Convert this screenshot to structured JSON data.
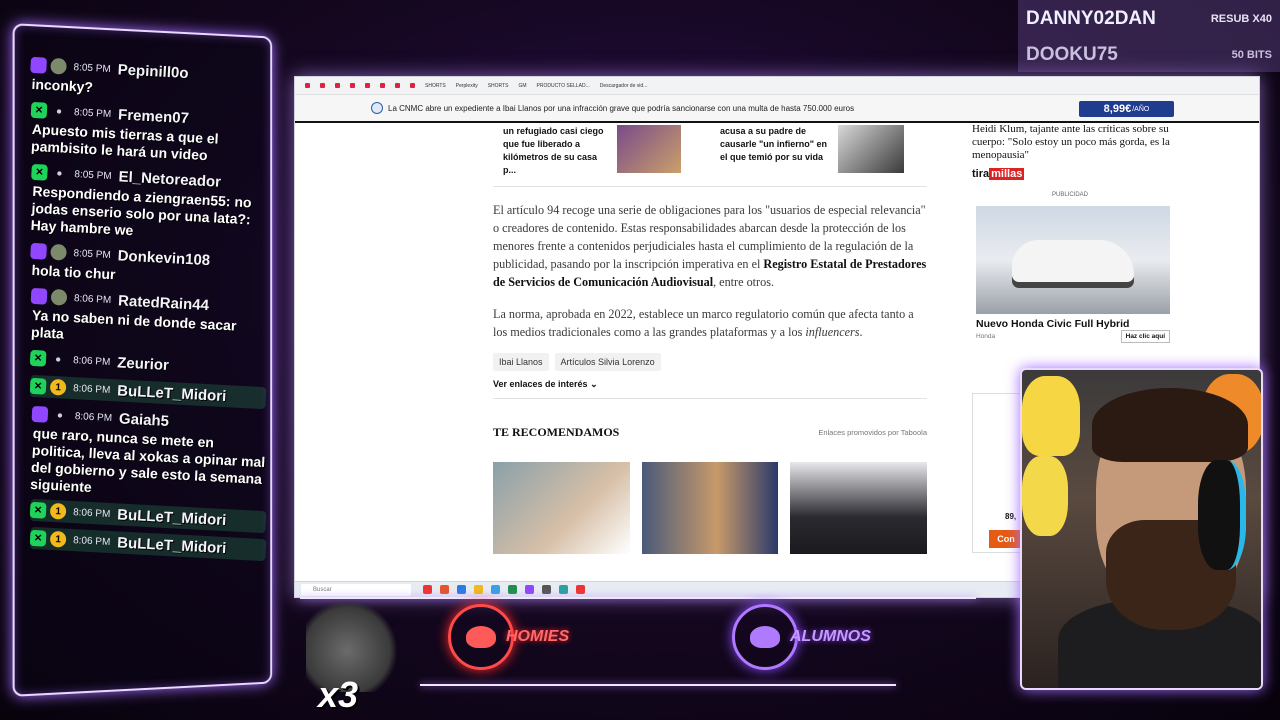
{
  "chat": {
    "messages": [
      {
        "time": "8:05 PM",
        "user": "Pepinill0o",
        "text": "inconky?",
        "badges": [
          "twitch-icon",
          "avatar-icon"
        ]
      },
      {
        "time": "8:05 PM",
        "user": "Fremen07",
        "text": "Apuesto mis tierras a que el pambisito le hará un video",
        "badges": [
          "kick-icon",
          "user-icon"
        ]
      },
      {
        "time": "8:05 PM",
        "user": "El_Netoreador",
        "text": "Respondiendo a ziengraen55: no jodas enserio solo por una lata?: Hay hambre we",
        "badges": [
          "kick-icon",
          "user-icon"
        ]
      },
      {
        "time": "8:05 PM",
        "user": "Donkevin108",
        "text": "hola tio chur",
        "badges": [
          "twitch-icon",
          "avatar-icon"
        ]
      },
      {
        "time": "8:06 PM",
        "user": "RatedRain44",
        "text": "Ya no saben ni de donde sacar plata",
        "badges": [
          "twitch-icon",
          "avatar-icon"
        ]
      },
      {
        "time": "8:06 PM",
        "user": "Zeurior",
        "text": "",
        "badges": [
          "kick-icon",
          "user-icon"
        ]
      },
      {
        "time": "8:06 PM",
        "user": "BuLLeT_Midori",
        "text": "",
        "badges": [
          "kick-icon",
          "sub-icon"
        ]
      },
      {
        "time": "8:06 PM",
        "user": "Gaiah5",
        "text": "que raro, nunca se mete en politica, lleva al xokas a opinar mal del gobierno y sale esto la semana siguiente",
        "badges": [
          "twitch-icon",
          "user-icon"
        ]
      },
      {
        "time": "8:06 PM",
        "user": "BuLLeT_Midori",
        "text": "",
        "badges": [
          "kick-icon",
          "sub-icon"
        ]
      },
      {
        "time": "8:06 PM",
        "user": "BuLLeT_Midori",
        "text": "",
        "badges": [
          "kick-icon",
          "sub-icon"
        ]
      }
    ],
    "sub_badge_count": "1"
  },
  "subs": {
    "top_name": "DANNY02DAN",
    "top_tag": "RESUB X40",
    "second_name": "DOOKU75",
    "second_tag": "50 BITS"
  },
  "browser": {
    "bookmarks": [
      "SHORTS",
      "Perplexity",
      "SHORTS",
      "GM",
      "PRODUCTO SELLAD...",
      "Descargador de vid..."
    ],
    "notice": "La CNMC abre un expediente a Ibai Llanos por una infracción grave que podría sancionarse con una multa de hasta 750.000 euros",
    "price": "8,99€",
    "price_unit": "/AÑO",
    "related": [
      {
        "text": "un refugiado casi ciego que fue liberado a kilómetros de su casa p..."
      },
      {
        "text": "acusa a su padre de causarle \"un infierno\" en el que temió por su vida"
      }
    ],
    "paragraph1_a": "El artículo 94 recoge una serie de obligaciones para los \"usuarios de especial relevancia\" o creadores de contenido. Estas responsabilidades abarcan desde la protección de los menores frente a contenidos perjudiciales hasta el cumplimiento de la regulación de la publicidad, pasando por la inscripción imperativa en el ",
    "paragraph1_bold": "Registro Estatal de Prestadores de Servicios de Comunicación Audiovisual",
    "paragraph1_b": ", entre otros.",
    "paragraph2_a": "La norma, aprobada en 2022, establece un marco regulatorio común que afecta tanto a los medios tradicionales como a las grandes plataformas y a los ",
    "paragraph2_em": "influencers",
    "paragraph2_b": ".",
    "tags": [
      "Ibai Llanos",
      "Artículos Silvia Lorenzo"
    ],
    "links_label": "Ver enlaces de interés",
    "rec_title": "TE RECOMENDAMOS",
    "rec_sponsor": "Enlaces promovidos por Taboola",
    "side_headline": "Heidi Klum, tajante ante las críticas sobre su cuerpo: \"Solo estoy un poco más gorda, es la menopausia\"",
    "side_logo_a": "tira",
    "side_logo_b": "millas",
    "publicidad": "PUBLICIDAD",
    "ad_title": "Nuevo Honda Civic Full Hybrid",
    "ad_brand": "Honda",
    "ad_cta": "Haz clic aquí",
    "ad2_price": "89,",
    "ad2_btn": "Con",
    "taskbar_search": "Buscar"
  },
  "overlay": {
    "logo1": "HOMIES",
    "logo2": "ALUMNOS",
    "fish_multiplier": "x3"
  }
}
